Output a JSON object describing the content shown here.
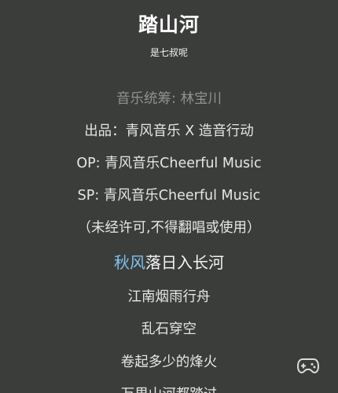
{
  "header": {
    "title": "踏山河",
    "artist": "是七叔呢"
  },
  "lyrics": {
    "credits_composer": "音乐统筹: 林宝川",
    "credits_producer": "出品：青风音乐 X 造音行动",
    "credits_op": "OP: 青风音乐Cheerful Music",
    "credits_sp": "SP: 青风音乐Cheerful Music",
    "notice": "（未经许可,不得翻唱或使用）",
    "current_sung": "秋风",
    "current_rest": "落日入长河",
    "next_1": "江南烟雨行舟",
    "next_2": "乱石穿空",
    "next_3": "卷起多少的烽火",
    "next_4": "万里山河都踏过"
  },
  "icons": {
    "gamepad": "gamepad-icon"
  },
  "colors": {
    "background": "#3b3d3b",
    "highlight": "#7fc3ee"
  }
}
